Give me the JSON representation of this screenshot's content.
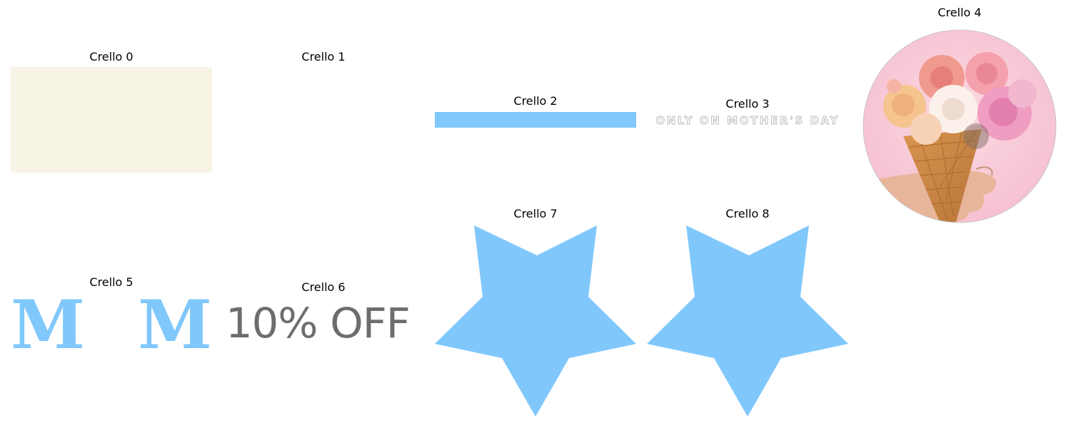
{
  "panels": [
    {
      "title": "Crello 0"
    },
    {
      "title": "Crello 1"
    },
    {
      "title": "Crello 2"
    },
    {
      "title": "Crello 3",
      "text": "ONLY ON MOTHER'S DAY"
    },
    {
      "title": "Crello 4"
    },
    {
      "title": "Crello 5",
      "text": "M  M"
    },
    {
      "title": "Crello 6",
      "text": "10% OFF"
    },
    {
      "title": "Crello 7"
    },
    {
      "title": "Crello 8"
    }
  ],
  "colors": {
    "cream": "#f7f4e5",
    "light_blue": "#80c8fc",
    "gray_text": "#6d6d6d",
    "pink_bg": "#f7c9d6"
  },
  "icons": {
    "panel_4": "flower-bouquet-image",
    "panel_7": "star-icon",
    "panel_8": "star-icon"
  }
}
